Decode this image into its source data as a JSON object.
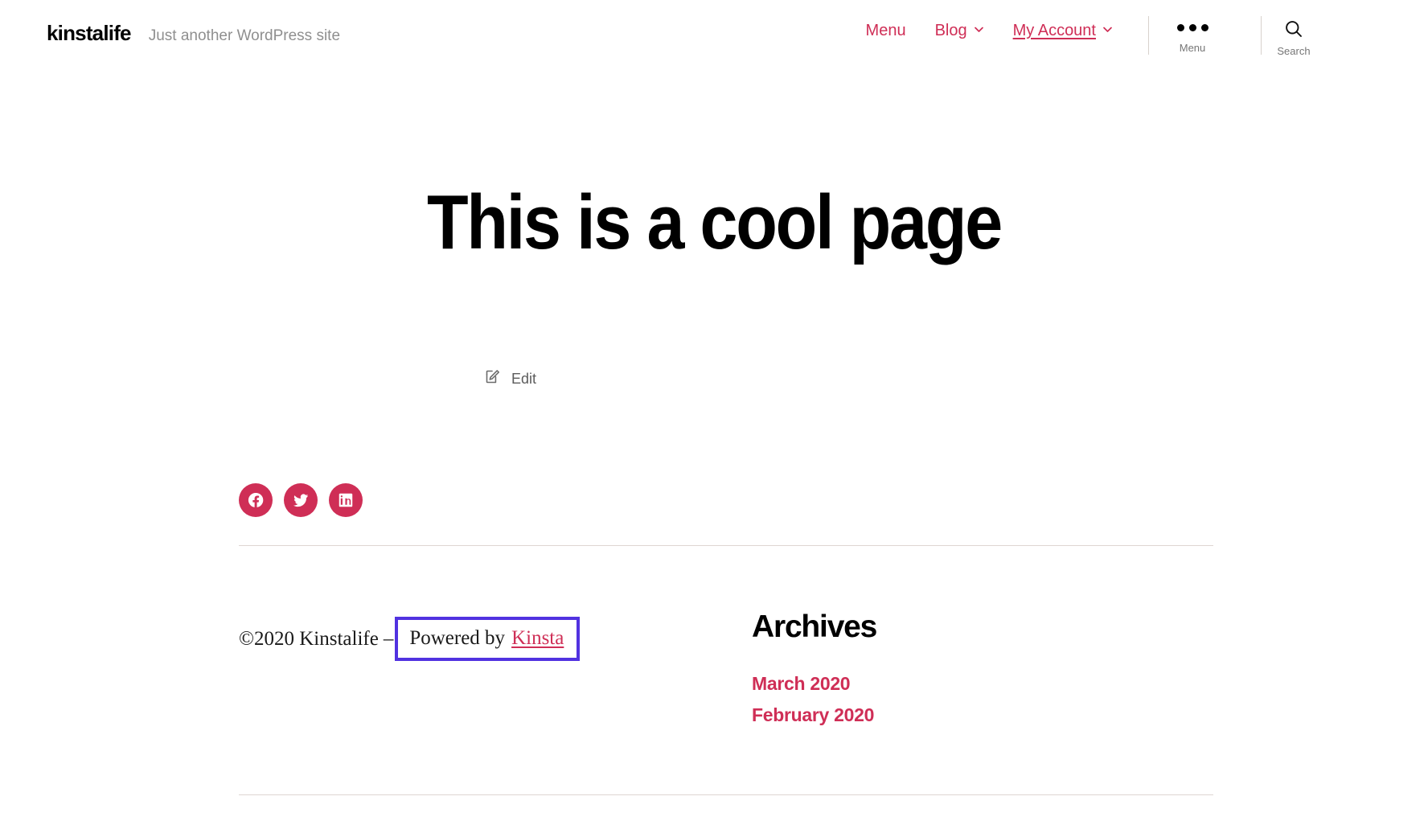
{
  "theme": {
    "accent": "#cf2e56",
    "highlight_box_border": "#5132e0",
    "divider": "#ded6d2",
    "muted_text": "#767676"
  },
  "header": {
    "site_title": "kinstalife",
    "site_description": "Just another WordPress site",
    "nav": [
      {
        "label": "Menu",
        "has_dropdown": false,
        "underlined": false,
        "icon": null
      },
      {
        "label": "Blog",
        "has_dropdown": true,
        "underlined": false,
        "icon": "chevron-down-icon"
      },
      {
        "label": "My Account",
        "has_dropdown": true,
        "underlined": true,
        "icon": "chevron-down-icon"
      }
    ],
    "menu_toggle": {
      "label": "Menu",
      "icon": "ellipsis-icon"
    },
    "search_toggle": {
      "label": "Search",
      "icon": "search-icon"
    }
  },
  "main": {
    "page_title": "This is a cool page",
    "edit": {
      "label": "Edit",
      "icon": "pencil-square-icon"
    },
    "social": [
      {
        "name": "facebook",
        "icon": "facebook-icon"
      },
      {
        "name": "twitter",
        "icon": "twitter-icon"
      },
      {
        "name": "linkedin",
        "icon": "linkedin-icon"
      }
    ]
  },
  "footer": {
    "copyright": "©2020 Kinstalife",
    "separator": "–",
    "powered_by_text": "Powered by",
    "powered_by_link": "Kinsta",
    "widget": {
      "title": "Archives",
      "items": [
        {
          "label": "March 2020"
        },
        {
          "label": "February 2020"
        }
      ]
    }
  }
}
